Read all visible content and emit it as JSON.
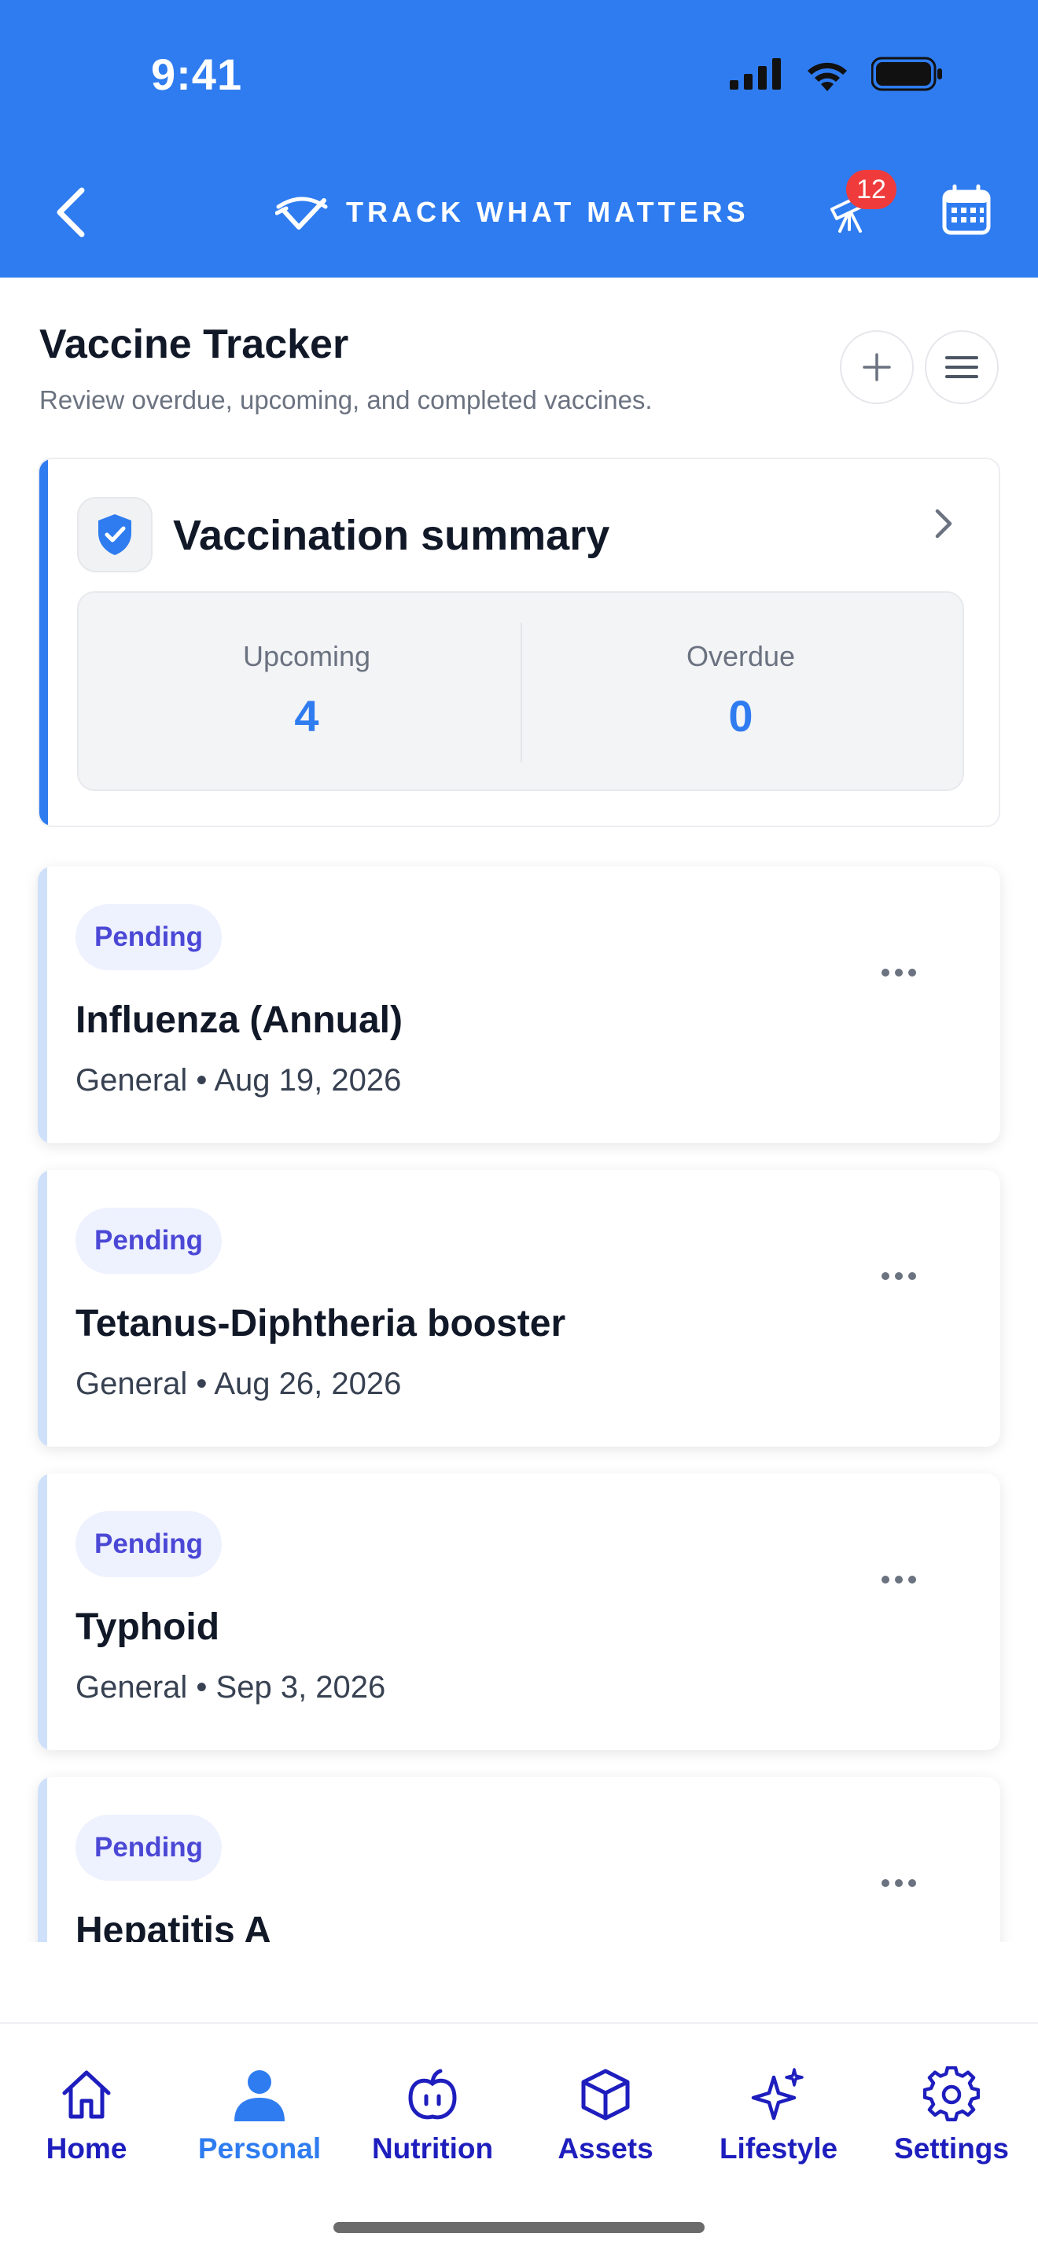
{
  "status_bar": {
    "time": "9:41"
  },
  "header": {
    "brand": "TRACK WHAT MATTERS",
    "notification_count": "12"
  },
  "page": {
    "title": "Vaccine Tracker",
    "subtitle": "Review overdue, upcoming, and completed vaccines."
  },
  "summary": {
    "title": "Vaccination summary",
    "upcoming_label": "Upcoming",
    "upcoming_value": "4",
    "overdue_label": "Overdue",
    "overdue_value": "0"
  },
  "vaccines": [
    {
      "status": "Pending",
      "name": "Influenza (Annual)",
      "meta": "General • Aug 19, 2026"
    },
    {
      "status": "Pending",
      "name": "Tetanus-Diphtheria booster",
      "meta": "General • Aug 26, 2026"
    },
    {
      "status": "Pending",
      "name": "Typhoid",
      "meta": "General • Sep 3, 2026"
    },
    {
      "status": "Pending",
      "name": "Hepatitis A",
      "meta": ""
    }
  ],
  "nav": {
    "items": [
      {
        "label": "Home",
        "icon": "home-icon"
      },
      {
        "label": "Personal",
        "icon": "person-icon"
      },
      {
        "label": "Nutrition",
        "icon": "apple-icon"
      },
      {
        "label": "Assets",
        "icon": "box-icon"
      },
      {
        "label": "Lifestyle",
        "icon": "sparkles-icon"
      },
      {
        "label": "Settings",
        "icon": "gear-icon"
      }
    ],
    "active": "Personal"
  },
  "colors": {
    "brand_blue": "#2f7cf0",
    "nav_navy": "#1e1ebe",
    "pill_text": "#4b48d6",
    "badge_red": "#ef3b3b"
  }
}
